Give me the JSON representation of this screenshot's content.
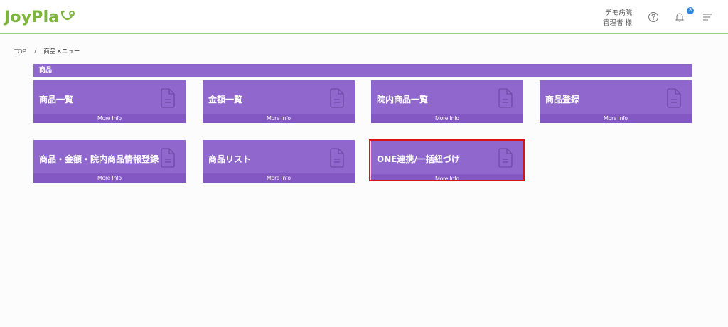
{
  "header": {
    "logo_text": "JoyPla",
    "hospital": "デモ病院",
    "user": "管理者 様",
    "notification_count": "3",
    "icons": [
      "help-icon",
      "bell-icon",
      "menu-icon"
    ],
    "accent_color": "#7db53c"
  },
  "breadcrumb": {
    "items": [
      "TOP",
      "商品メニュー"
    ],
    "separator": "/"
  },
  "section": {
    "title": "商品",
    "color": "#9068cd"
  },
  "cards": [
    {
      "title": "商品一覧",
      "footer": "More Info",
      "icon": "document-icon"
    },
    {
      "title": "金額一覧",
      "footer": "More Info",
      "icon": "document-icon"
    },
    {
      "title": "院内商品一覧",
      "footer": "More Info",
      "icon": "document-icon"
    },
    {
      "title": "商品登録",
      "footer": "More Info",
      "icon": "document-icon"
    },
    {
      "title": "商品・金額・院内商品情報登録",
      "footer": "More Info",
      "icon": "document-icon"
    },
    {
      "title": "商品リスト",
      "footer": "More Info",
      "icon": "document-icon"
    },
    {
      "title": "ONE連携/一括紐づけ",
      "footer": "More Info",
      "icon": "document-icon",
      "highlighted": true
    }
  ]
}
